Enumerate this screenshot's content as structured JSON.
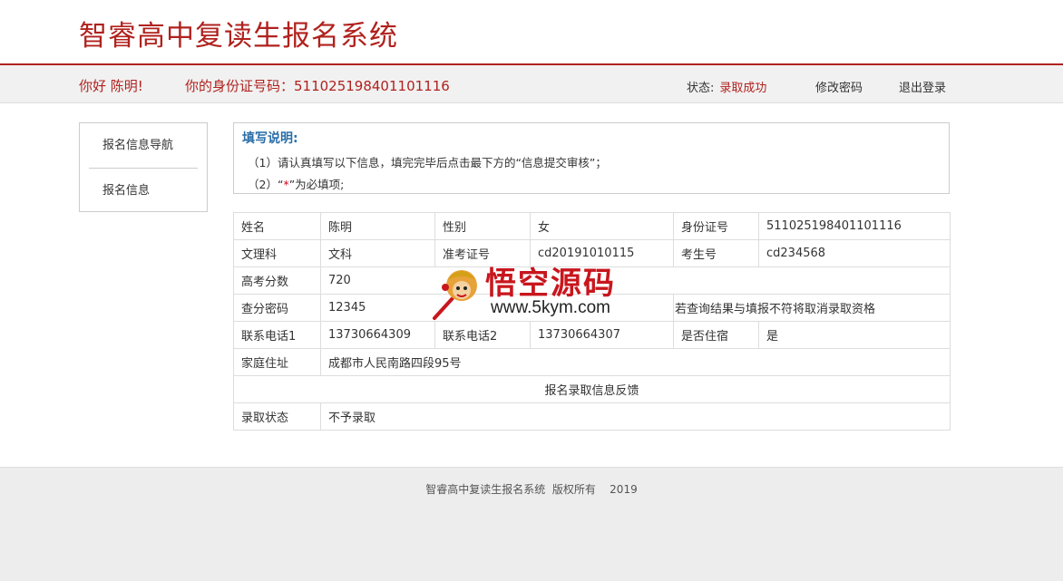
{
  "header": {
    "title": "智睿高中复读生报名系统"
  },
  "userbar": {
    "greeting": "你好 陈明!",
    "id_label_value": "你的身份证号码：511025198401101116",
    "status_label": "状态:",
    "status_value": "录取成功",
    "change_password": "修改密码",
    "logout": "退出登录"
  },
  "sidenav": {
    "items": [
      {
        "label": "报名信息导航"
      },
      {
        "label": "报名信息"
      }
    ]
  },
  "notes": {
    "title": "填写说明:",
    "line1": "（1）请认真填写以下信息，填完完毕后点击最下方的“信息提交审核”；",
    "line2_pre": "（2）“",
    "line2_star": "*",
    "line2_post": "”为必填项;"
  },
  "table": {
    "name_label": "姓名",
    "name": "陈明",
    "gender_label": "性别",
    "gender": "女",
    "idcard_label": "身份证号",
    "idcard": "511025198401101116",
    "track_label": "文理科",
    "track": "文科",
    "admit_label": "准考证号",
    "admit": "cd20191010115",
    "examinee_label": "考生号",
    "examinee": "cd234568",
    "score_label": "高考分数",
    "score": "720",
    "pwd_label": "查分密码",
    "pwd": "12345",
    "pwd_note": "若查询结果与填报不符将取消录取资格",
    "phone1_label": "联系电话1",
    "phone1": "13730664309",
    "phone2_label": "联系电话2",
    "phone2": "13730664307",
    "board_label": "是否住宿",
    "board": "是",
    "addr_label": "家庭住址",
    "addr": "成都市人民南路四段95号",
    "feedback_header": "报名录取信息反馈",
    "result_label": "录取状态",
    "result": "不予录取"
  },
  "watermark": {
    "text": "悟空源码",
    "url": "www.5kym.com",
    "icon": "monkey-king-logo"
  },
  "footer": {
    "copyright": "智睿高中复读生报名系统  版权所有    2019"
  },
  "colors": {
    "brand": "#b0221e",
    "notes_title": "#2a6ea8"
  }
}
